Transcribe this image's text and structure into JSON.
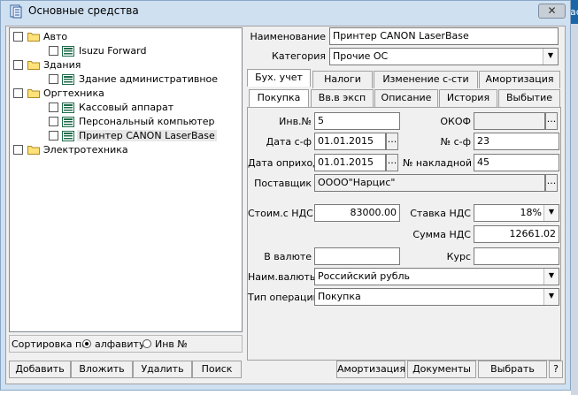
{
  "window": {
    "title": "Основные средства",
    "close_glyph": "✕",
    "background_fragment": "ас"
  },
  "tree": {
    "nodes": [
      {
        "label": "Авто",
        "level": 0,
        "icon": "folder-icon"
      },
      {
        "label": "Isuzu Forward",
        "level": 1,
        "icon": "record-icon"
      },
      {
        "label": "Здания",
        "level": 0,
        "icon": "folder-icon"
      },
      {
        "label": "Здание административное",
        "level": 1,
        "icon": "record-icon"
      },
      {
        "label": "Оргтехника",
        "level": 0,
        "icon": "folder-icon"
      },
      {
        "label": "Кассовый аппарат",
        "level": 1,
        "icon": "record-icon"
      },
      {
        "label": "Персональный компьютер",
        "level": 1,
        "icon": "record-icon"
      },
      {
        "label": "Принтер CANON LaserBase",
        "level": 1,
        "icon": "record-icon",
        "selected": true
      },
      {
        "label": "Электротехника",
        "level": 0,
        "icon": "folder-icon"
      }
    ]
  },
  "sort": {
    "label": "Сортировка по",
    "option_alpha": "алфавиту",
    "option_inv": "Инв №",
    "selected": "alpha"
  },
  "left_buttons": {
    "add": "Добавить",
    "insert": "Вложить",
    "delete": "Удалить",
    "search": "Поиск"
  },
  "header": {
    "name_label": "Наименование",
    "name_value": "Принтер CANON LaserBase",
    "category_label": "Категория",
    "category_value": "Прочие ОС"
  },
  "tabs_top": [
    "Бух. учет",
    "Налоги",
    "Изменение с-сти",
    "Амортизация"
  ],
  "tabs_bottom": [
    "Покупка",
    "Вв.в эксп",
    "Описание",
    "История",
    "Выбытие"
  ],
  "form": {
    "inv_label": "Инв.№",
    "inv_value": "5",
    "okof_label": "ОКОФ",
    "okof_value": "",
    "date_sf_label": "Дата с-ф",
    "date_sf_value": "01.01.2015",
    "num_sf_label": "№ с-ф",
    "num_sf_value": "23",
    "date_opr_label": "Дата оприход",
    "date_opr_value": "01.01.2015",
    "nakl_label": "№ накладной",
    "nakl_value": "45",
    "supplier_label": "Поставщик",
    "supplier_value": "ОООО\"Нарцис\"",
    "cost_label": "Стоим.с НДС",
    "cost_value": "83000.00",
    "vat_rate_label": "Ставка НДС",
    "vat_rate_value": "18%",
    "vat_sum_label": "Сумма НДС",
    "vat_sum_value": "12661.02",
    "currency_amount_label": "В валюте",
    "currency_amount_value": "",
    "rate_label": "Курс",
    "rate_value": "",
    "currency_name_label": "Наим.валюты",
    "currency_name_value": "Российский рубль",
    "operation_label": "Тип операции",
    "operation_value": "Покупка",
    "dots": "..."
  },
  "bottom_buttons": {
    "amort": "Амортизация",
    "docs": "Документы",
    "choose": "Выбрать",
    "help": "?"
  }
}
